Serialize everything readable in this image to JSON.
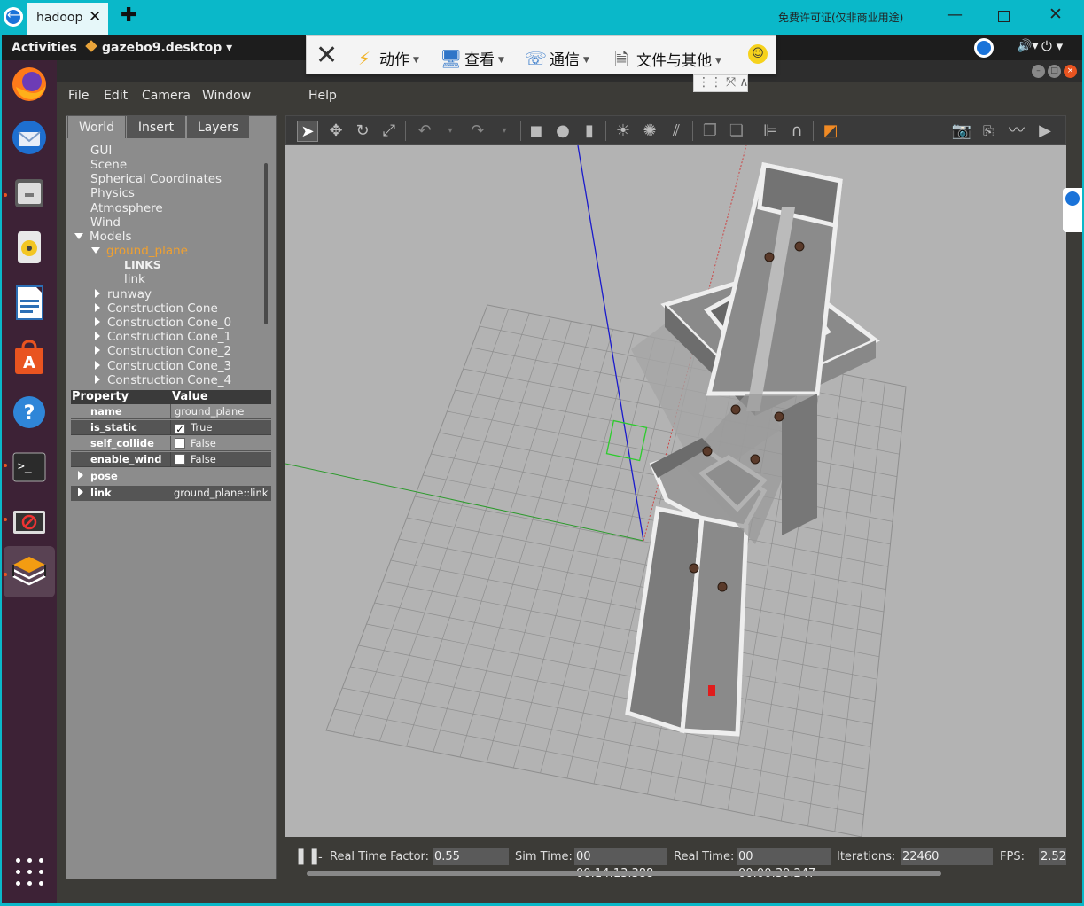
{
  "teamviewer": {
    "tab_label": "hadoop",
    "tab_close": "✕",
    "new_tab": "✚",
    "license_text": "免费许可证(仅非商业用途)",
    "min": "—",
    "close": "✕",
    "toolbar": {
      "close": "✕",
      "actions": "动作",
      "view": "查看",
      "communicate": "通信",
      "files": "文件与其他"
    }
  },
  "topbar": {
    "activities": "Activities",
    "app_name": "gazebo9.desktop ▾",
    "volume": "🔊▾",
    "power": "⏻ ▾"
  },
  "menubar": {
    "file": "File",
    "edit": "Edit",
    "camera": "Camera",
    "window": "Window",
    "help": "Help"
  },
  "left_tabs": [
    "World",
    "Insert",
    "Layers"
  ],
  "tree": {
    "items": [
      "GUI",
      "Scene",
      "Spherical Coordinates",
      "Physics",
      "Atmosphere",
      "Wind"
    ],
    "models_label": "Models",
    "selected_model": "ground_plane",
    "links_label": "LINKS",
    "link_label": "link",
    "models": [
      "runway",
      "Construction Cone",
      "Construction Cone_0",
      "Construction Cone_1",
      "Construction Cone_2",
      "Construction Cone_3",
      "Construction Cone_4"
    ]
  },
  "properties": {
    "header_property": "Property",
    "header_value": "Value",
    "rows": [
      {
        "name": "name",
        "value": "ground_plane"
      },
      {
        "name": "is_static",
        "value": "True"
      },
      {
        "name": "self_collide",
        "value": "False"
      },
      {
        "name": "enable_wind",
        "value": "False"
      },
      {
        "name": "pose",
        "value": ""
      },
      {
        "name": "link",
        "value": "ground_plane::link"
      }
    ]
  },
  "status": {
    "pause_icon": "❚❚",
    "rtf_label": "Real Time Factor:",
    "rtf_value": "0.55",
    "sim_time_label": "Sim Time:",
    "sim_time_value": "00 00:14:13.388",
    "real_time_label": "Real Time:",
    "real_time_value": "00 00:00:39.247",
    "iterations_label": "Iterations:",
    "iterations_value": "22460",
    "fps_label": "FPS:",
    "fps_value": "2.52"
  },
  "colors": {
    "teamviewer": "#0ab8c9",
    "selected": "#f0a030",
    "scene_bg": "#b3b3b3",
    "dock": "#3d2236"
  }
}
